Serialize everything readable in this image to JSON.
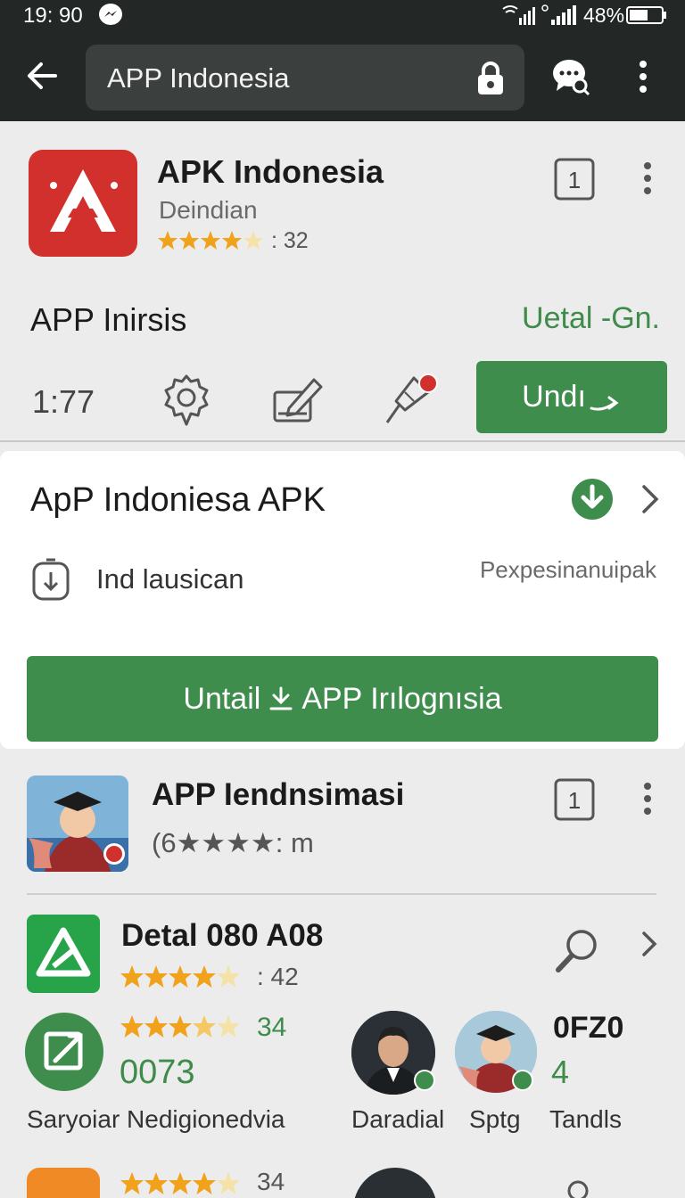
{
  "status_bar": {
    "time": "19: 90",
    "battery": "48%"
  },
  "toolbar": {
    "search_value": "APP Indonesia"
  },
  "featured": {
    "title": "APK Indonesia",
    "developer": "Deindian",
    "rating_count": ": 32",
    "rating": 4.5,
    "badge": "1",
    "subtitle": "APP Inirsis",
    "status": "Uetal -Gn.",
    "time": "1:77",
    "action_label": "Undı"
  },
  "details": {
    "title": "ApP Indoniesa APK",
    "label": "Ind lausican",
    "right_text": "Pexpesinanuipak",
    "install_label_left": "Untail",
    "install_label_right": "APP Irılognısia"
  },
  "list": {
    "item1": {
      "title": "APP Iendnsimasi",
      "rating_text": "(6★★★★: m",
      "badge": "1"
    },
    "item2": {
      "title": "Detal 080 A08",
      "rating_count": ": 42",
      "rating": 4.5
    },
    "row3": {
      "stars_count": "34",
      "number": "0073",
      "label": "Saryoiar Nedigionedvia",
      "right_title": "0FZ0",
      "right_num": "4",
      "avatar1_label": "Daradial",
      "avatar2_label": "Sptg",
      "label_right": "Tandls"
    },
    "row4": {
      "stars_count": "34"
    }
  },
  "colors": {
    "accent": "#3f8d4d",
    "bar": "#232826",
    "star": "#f0a21b",
    "app_red": "#d2302c"
  }
}
